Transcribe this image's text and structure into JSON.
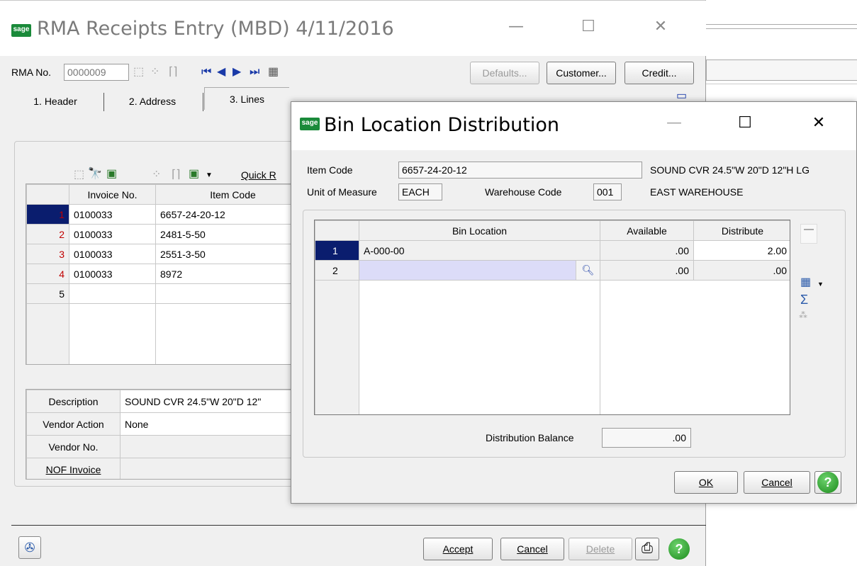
{
  "main_window": {
    "title": "RMA Receipts Entry (MBD) 4/11/2016",
    "logo": "sage",
    "window_controls": {
      "minimize": "—",
      "maximize": "☐",
      "close": "✕"
    },
    "rma_label": "RMA No.",
    "rma_value": "0000009",
    "buttons": {
      "defaults": "Defaults...",
      "customer": "Customer...",
      "credit": "Credit..."
    },
    "tabs": [
      {
        "label": "1. Header"
      },
      {
        "label": "2. Address"
      },
      {
        "label": "3. Lines"
      }
    ],
    "quick_label": "Quick R",
    "grid": {
      "headers": [
        "Invoice No.",
        "Item Code"
      ],
      "rows": [
        {
          "num": "1",
          "invoice": "0100033",
          "item": "6657-24-20-12"
        },
        {
          "num": "2",
          "invoice": "0100033",
          "item": "2481-5-50"
        },
        {
          "num": "3",
          "invoice": "0100033",
          "item": "2551-3-50"
        },
        {
          "num": "4",
          "invoice": "0100033",
          "item": "8972"
        },
        {
          "num": "5",
          "invoice": "",
          "item": ""
        }
      ]
    },
    "details": [
      {
        "label": "Description",
        "value": "SOUND CVR 24.5\"W 20\"D 12\""
      },
      {
        "label": "Vendor Action",
        "value": "None"
      },
      {
        "label": "Vendor No.",
        "value": ""
      },
      {
        "label": "NOF Invoice",
        "value": ""
      }
    ],
    "footer_buttons": {
      "accept": "Accept",
      "cancel": "Cancel",
      "delete": "Delete"
    }
  },
  "dialog": {
    "title": "Bin Location Distribution",
    "logo": "sage",
    "window_controls": {
      "minimize": "—",
      "maximize": "☐",
      "close": "✕"
    },
    "item_code_label": "Item Code",
    "item_code_value": "6657-24-20-12",
    "item_description": "SOUND CVR 24.5\"W 20\"D 12\"H LG",
    "uom_label": "Unit of Measure",
    "uom_value": "EACH",
    "warehouse_label": "Warehouse Code",
    "warehouse_value": "001",
    "warehouse_name": "EAST WAREHOUSE",
    "grid": {
      "headers": [
        "Bin Location",
        "Available",
        "Distribute"
      ],
      "rows": [
        {
          "num": "1",
          "bin": "A-000-00",
          "available": ".00",
          "distribute": "2.00"
        },
        {
          "num": "2",
          "bin": "",
          "available": ".00",
          "distribute": ".00"
        }
      ]
    },
    "balance_label": "Distribution Balance",
    "balance_value": ".00",
    "buttons": {
      "ok": "OK",
      "cancel": "Cancel"
    }
  }
}
